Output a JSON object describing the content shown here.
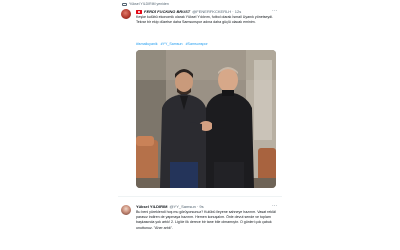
{
  "retweet": {
    "label": "Yüksel YILDIRIM yeniden"
  },
  "tweet1": {
    "author_name": "FERDİ FUCKING BRUST",
    "author_handle": "@FENERFKCKERLH · 12s",
    "text": "Keşke kulübü ekonomik olarak Yüksel Yıldırım, futbol olarak İsmail Uyanık yönetseydi. Tekrar bir ekip düzelse daha Samsunspor adına daha güçlü olacak eminim.",
    "hashtags": [
      "#ismailuyanik",
      "#YY_Samsun",
      "#Samsunspor"
    ],
    "colors": {
      "flag": "#e30a17",
      "link": "#1d9bf0"
    }
  },
  "tweet2": {
    "author_name": "Yüksel YILDIRIM",
    "author_handle": "@YY_Samsun · 9s",
    "text": "Bu beni yüreklendi hoş mu görüyorsunuz? Kulübü ileyenе sahneye hazırım. Vasat reklâl parasız indiren de yapmaya hazırım. Hemen konuşalım. Önle devut sende ve toplam başkasında yok artık! 2. Lig'de ilk derece bir tane bile olmamıştır. O günleri çok çabuk unuttunuz. \"Aher artık\"."
  },
  "icons": {
    "more": "more-icon",
    "retweet": "retweet-icon"
  }
}
